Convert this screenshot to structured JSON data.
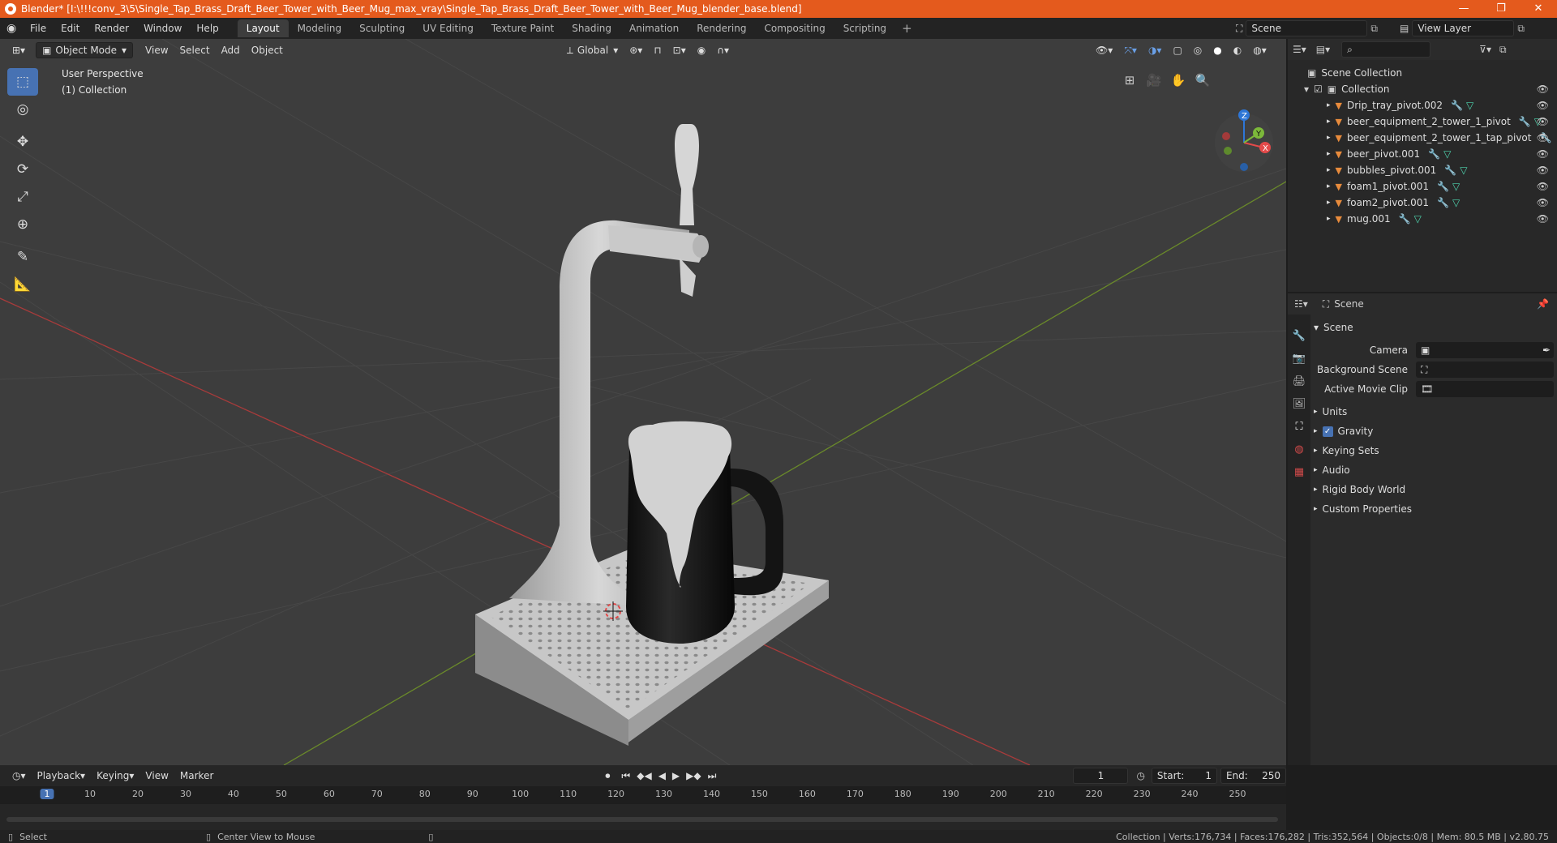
{
  "window": {
    "title": "Blender* [I:\\!!!conv_3\\5\\Single_Tap_Brass_Draft_Beer_Tower_with_Beer_Mug_max_vray\\Single_Tap_Brass_Draft_Beer_Tower_with_Beer_Mug_blender_base.blend]",
    "minimize": "—",
    "maximize": "❐",
    "close": "✕"
  },
  "menu": {
    "items": [
      "File",
      "Edit",
      "Render",
      "Window",
      "Help"
    ],
    "workspaces": [
      "Layout",
      "Modeling",
      "Sculpting",
      "UV Editing",
      "Texture Paint",
      "Shading",
      "Animation",
      "Rendering",
      "Compositing",
      "Scripting"
    ],
    "active_workspace": "Layout",
    "scene_label": "Scene",
    "view_layer_label": "View Layer"
  },
  "viewport": {
    "mode": "Object Mode",
    "header_menus": [
      "View",
      "Select",
      "Add",
      "Object"
    ],
    "transform_orientation": "Global",
    "overlay_line1": "User Perspective",
    "overlay_line2": "(1) Collection",
    "gizmo_axes": [
      "X",
      "Y",
      "Z"
    ]
  },
  "outliner": {
    "root": "Scene Collection",
    "collection": "Collection",
    "items": [
      {
        "name": "Drip_tray_pivot.002"
      },
      {
        "name": "beer_equipment_2_tower_1_pivot"
      },
      {
        "name": "beer_equipment_2_tower_1_tap_pivot"
      },
      {
        "name": "beer_pivot.001"
      },
      {
        "name": "bubbles_pivot.001"
      },
      {
        "name": "foam1_pivot.001"
      },
      {
        "name": "foam2_pivot.001"
      },
      {
        "name": "mug.001"
      }
    ]
  },
  "properties": {
    "context": "Scene",
    "section": "Scene",
    "fields": [
      {
        "label": "Camera",
        "value": ""
      },
      {
        "label": "Background Scene",
        "value": ""
      },
      {
        "label": "Active Movie Clip",
        "value": ""
      }
    ],
    "subpanels": [
      "Units",
      "Gravity",
      "Keying Sets",
      "Audio",
      "Rigid Body World",
      "Custom Properties"
    ]
  },
  "timeline": {
    "menus": [
      "Playback",
      "Keying",
      "View",
      "Marker"
    ],
    "current_frame": "1",
    "start_label": "Start:",
    "start": "1",
    "end_label": "End:",
    "end": "250",
    "ticks": [
      "1",
      "10",
      "20",
      "30",
      "40",
      "50",
      "60",
      "70",
      "80",
      "90",
      "100",
      "110",
      "120",
      "130",
      "140",
      "150",
      "160",
      "170",
      "180",
      "190",
      "200",
      "210",
      "220",
      "230",
      "240",
      "250"
    ]
  },
  "status": {
    "left1": "Select",
    "left2": "Center View to Mouse",
    "right": "Collection | Verts:176,734 | Faces:176,282 | Tris:352,564 | Objects:0/8 | Mem: 80.5 MB | v2.80.75"
  }
}
